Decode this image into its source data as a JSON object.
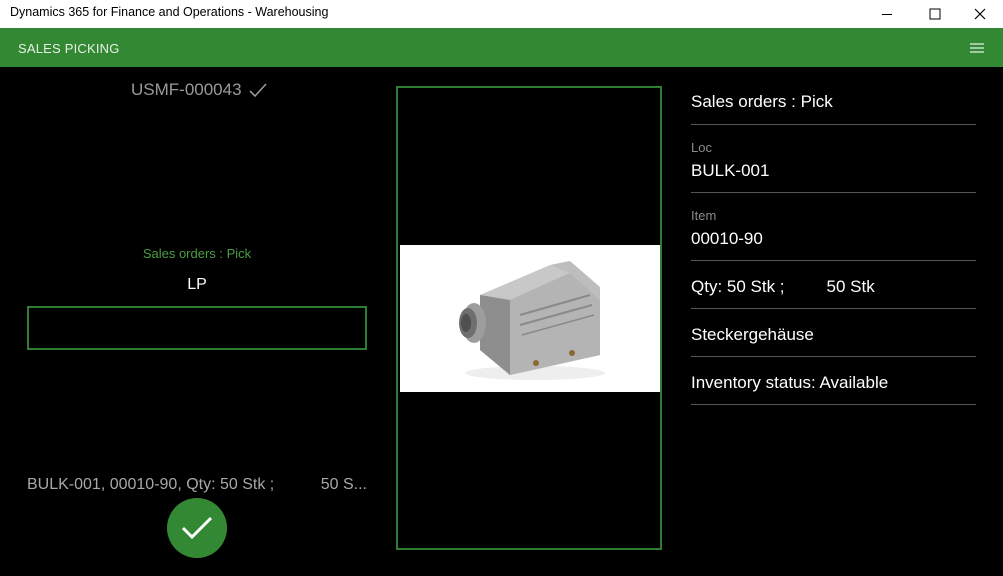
{
  "window": {
    "title": "Dynamics 365 for Finance and Operations - Warehousing"
  },
  "appbar": {
    "title": "SALES PICKING"
  },
  "left": {
    "work_id": "USMF-000043",
    "subtitle": "Sales orders : Pick",
    "field_label": "LP",
    "field_value": "",
    "summary_main": "BULK-001, 00010-90, Qty: 50 Stk ;",
    "summary_tail": "50 S..."
  },
  "details": {
    "header": "Sales orders : Pick",
    "loc_label": "Loc",
    "loc_value": "BULK-001",
    "item_label": "Item",
    "item_value": "00010-90",
    "qty_a": "Qty: 50 Stk ;",
    "qty_b": "50 Stk",
    "description": "Steckergehäuse",
    "inventory_status": "Inventory status: Available"
  },
  "colors": {
    "accent": "#338833",
    "accent_border": "#2e7d32",
    "background": "#000000"
  },
  "icons": {
    "minimize": "minimize-icon",
    "maximize": "maximize-icon",
    "close": "close-icon",
    "menu": "hamburger-menu-icon",
    "check": "checkmark-icon",
    "confirm": "ok-checkmark-icon"
  }
}
